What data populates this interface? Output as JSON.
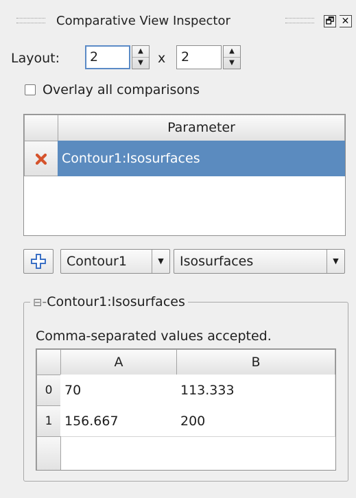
{
  "title_bar": {
    "title": "Comparative View Inspector",
    "float_glyph": "🗗",
    "close_glyph": "✕"
  },
  "layout": {
    "label": "Layout:",
    "rows_value": "2",
    "separator": "x",
    "cols_value": "2"
  },
  "overlay": {
    "label": "Overlay all comparisons",
    "checked": false
  },
  "parameter_table": {
    "header": "Parameter",
    "rows": [
      {
        "label": "Contour1:Isosurfaces",
        "selected": true
      }
    ]
  },
  "add_bar": {
    "source_value": "Contour1",
    "property_value": "Isosurfaces"
  },
  "group": {
    "title": "Contour1:Isosurfaces",
    "collapse_glyph": "⊟",
    "hint": "Comma-separated values accepted.",
    "columns": [
      "A",
      "B"
    ],
    "rows": [
      {
        "index": "0",
        "cells": [
          "70",
          "113.333"
        ]
      },
      {
        "index": "1",
        "cells": [
          "156.667",
          "200"
        ]
      }
    ]
  },
  "colors": {
    "selection": "#5b8bbf",
    "remove_icon": "#d5532c",
    "add_icon": "#3a6fc4"
  },
  "icons": {
    "remove": "remove-icon",
    "add": "add-icon",
    "spin_up": "▲",
    "spin_down": "▼",
    "combo_arrow": "▼"
  }
}
